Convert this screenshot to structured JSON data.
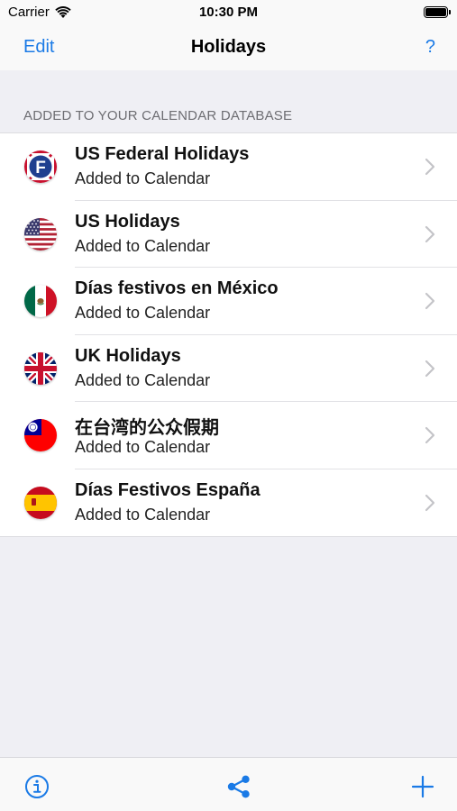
{
  "status_bar": {
    "carrier": "Carrier",
    "time": "10:30 PM"
  },
  "nav": {
    "edit_label": "Edit",
    "title": "Holidays",
    "help_label": "?"
  },
  "section": {
    "header": "ADDED TO YOUR CALENDAR DATABASE"
  },
  "items": [
    {
      "title": "US Federal Holidays",
      "subtitle": "Added to Calendar",
      "flag": "us-federal-flag-icon"
    },
    {
      "title": "US Holidays",
      "subtitle": "Added to Calendar",
      "flag": "us-flag-icon"
    },
    {
      "title": "Días festivos en México",
      "subtitle": "Added to Calendar",
      "flag": "mexico-flag-icon"
    },
    {
      "title": "UK Holidays",
      "subtitle": "Added to Calendar",
      "flag": "uk-flag-icon"
    },
    {
      "title": "在台湾的公众假期",
      "subtitle": "Added to Calendar",
      "flag": "taiwan-flag-icon"
    },
    {
      "title": "Días Festivos España",
      "subtitle": "Added to Calendar",
      "flag": "spain-flag-icon"
    }
  ],
  "toolbar": {
    "info_icon": "info-icon",
    "share_icon": "share-icon",
    "add_icon": "plus-icon"
  },
  "colors": {
    "accent": "#1a7ae6",
    "background": "#efeff4"
  }
}
